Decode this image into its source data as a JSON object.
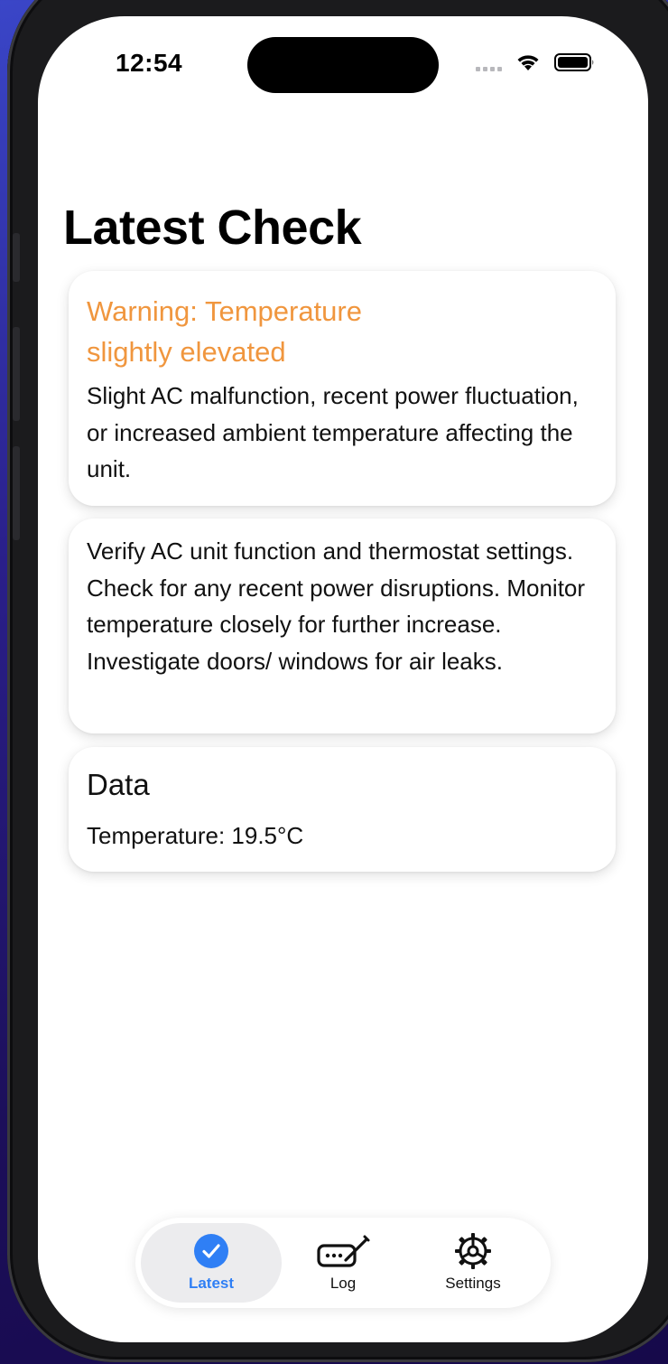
{
  "status_bar": {
    "time": "12:54"
  },
  "page": {
    "title": "Latest Check"
  },
  "cards": {
    "status": {
      "title": "Warning: Temperature slightly elevated",
      "body": "Slight AC malfunction, recent power fluctuation, or increased ambient temperature affecting the unit."
    },
    "recommendation": {
      "body": "Verify AC unit function and thermostat settings. Check for any recent power disruptions. Monitor temperature closely for further increase. Investigate doors/ windows for air leaks."
    },
    "data": {
      "title": "Data",
      "temperature": "Temperature: 19.5°C"
    }
  },
  "tabs": [
    {
      "label": "Latest",
      "icon": "checkmark-circle-icon",
      "selected": true
    },
    {
      "label": "Log",
      "icon": "keyboard-pencil-icon",
      "selected": false
    },
    {
      "label": "Settings",
      "icon": "gear-icon",
      "selected": false
    }
  ],
  "colors": {
    "warning": "#f0963e",
    "accent": "#2f7ff5"
  }
}
